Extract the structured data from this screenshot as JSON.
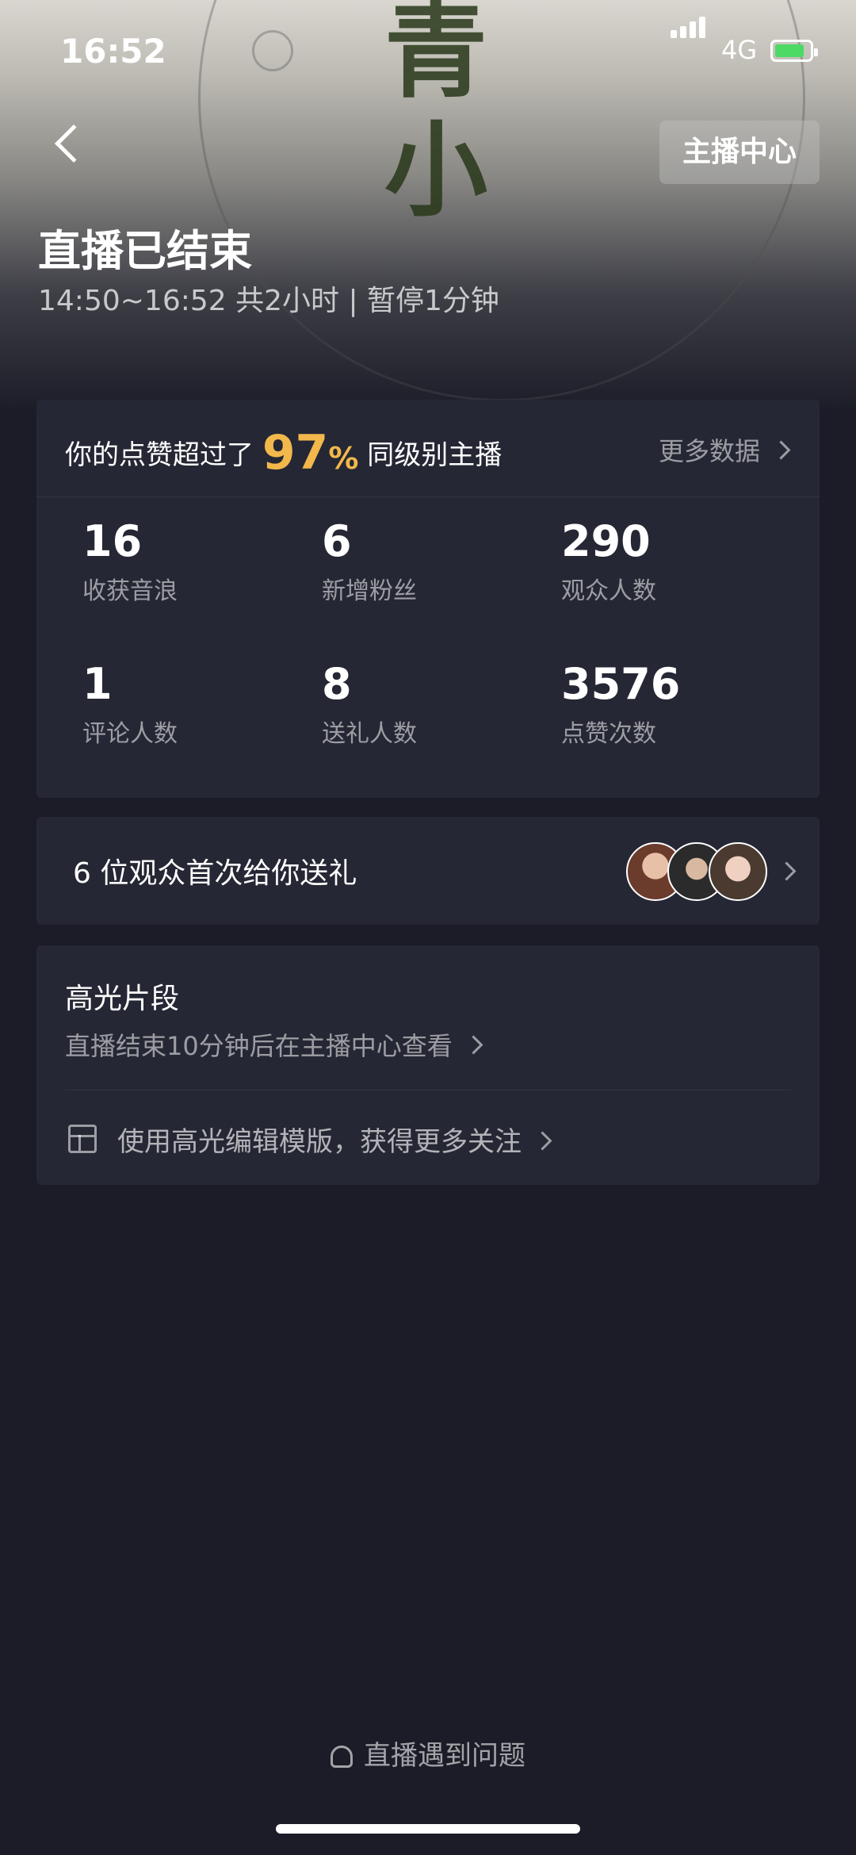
{
  "status_bar": {
    "time": "16:52",
    "network": "4G"
  },
  "header": {
    "back_icon": "back-chevron-icon",
    "host_center_label": "主播中心",
    "title": "直播已结束",
    "subtitle": "14:50~16:52 共2小时 | 暂停1分钟"
  },
  "likes_card": {
    "prefix": "你的点赞超过了",
    "percent": "97",
    "percent_unit": "%",
    "suffix": "同级别主播",
    "more_label": "更多数据"
  },
  "stats": [
    {
      "value": "16",
      "label": "收获音浪"
    },
    {
      "value": "6",
      "label": "新增粉丝"
    },
    {
      "value": "290",
      "label": "观众人数"
    },
    {
      "value": "1",
      "label": "评论人数"
    },
    {
      "value": "8",
      "label": "送礼人数"
    },
    {
      "value": "3576",
      "label": "点赞次数"
    }
  ],
  "gift_card": {
    "label": "6 位观众首次给你送礼",
    "avatar_count": 3
  },
  "highlight_card": {
    "title": "高光片段",
    "subtitle": "直播结束10分钟后在主播中心查看",
    "template_label": "使用高光编辑模版，获得更多关注"
  },
  "footer": {
    "help_label": "直播遇到问题"
  },
  "colors": {
    "background": "#1b1c27",
    "card": "#252734",
    "accent": "#f2b84b"
  }
}
